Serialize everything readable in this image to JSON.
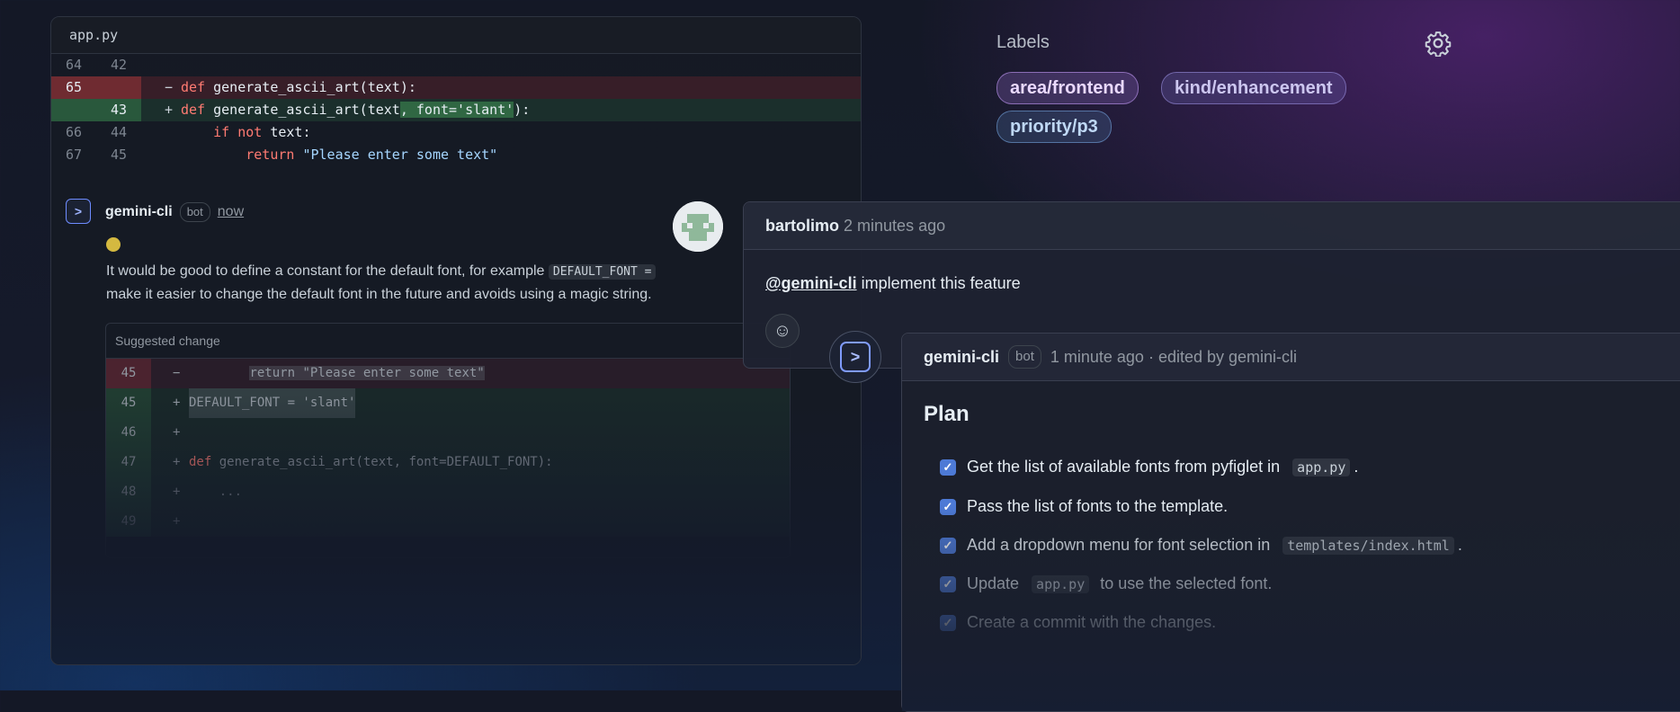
{
  "diff": {
    "filename": "app.py",
    "rows": [
      {
        "old": "64",
        "new": "42",
        "sign": "",
        "code": ""
      },
      {
        "old": "65",
        "new": "",
        "sign": "−",
        "code_kw": "def",
        "code_rest": " generate_ascii_art(text):"
      },
      {
        "old": "",
        "new": "43",
        "sign": "+",
        "code_kw": "def",
        "code_rest": " generate_ascii_art(text",
        "code_hl": ", font='slant'",
        "code_tail": "):"
      },
      {
        "old": "66",
        "new": "44",
        "code_indent": "    ",
        "code_kw": "if not",
        "code_rest": " text:"
      },
      {
        "old": "67",
        "new": "45",
        "code_indent": "        ",
        "code_kw": "return",
        "code_str": " \"Please enter some text\""
      }
    ]
  },
  "bot_comment": {
    "author": "gemini-cli",
    "badge": "bot",
    "time": "now",
    "body_part1": "It would be good to define a constant for the default font, for example",
    "body_code": "DEFAULT_FONT =",
    "body_part2": "make it easier to change the default font in the future and avoids using a magic string.",
    "suggested_title": "Suggested change",
    "suggestion_rows": [
      {
        "ln": "45",
        "sign": "−",
        "code_pre": "        ",
        "code": "return \"Please enter some text\"",
        "type": "del"
      },
      {
        "ln": "45",
        "sign": "+",
        "code": "DEFAULT_FONT = 'slant'",
        "type": "add"
      },
      {
        "ln": "46",
        "sign": "+",
        "code": "",
        "type": "add"
      },
      {
        "ln": "47",
        "sign": "+",
        "code_kw": "def",
        "code": " generate_ascii_art(text, font=DEFAULT_FONT):",
        "type": "add"
      },
      {
        "ln": "48",
        "sign": "+",
        "code": "    ...",
        "type": "add"
      },
      {
        "ln": "49",
        "sign": "+",
        "code": "",
        "type": "add"
      }
    ]
  },
  "labels": {
    "title": "Labels",
    "items": [
      "area/frontend",
      "kind/enhancement",
      "priority/p3"
    ]
  },
  "user_comment": {
    "author": "bartolimo",
    "time": "2 minutes ago",
    "mention": "@gemini-cli",
    "text": " implement this feature"
  },
  "plan_comment": {
    "author": "gemini-cli",
    "badge": "bot",
    "meta": "1 minute ago · edited by gemini-cli",
    "title": "Plan",
    "tasks": [
      {
        "pre": "Get the list of available fonts from pyfiglet in",
        "code": "app.py",
        "post": "."
      },
      {
        "pre": "Pass the list of fonts to the template.",
        "code": "",
        "post": ""
      },
      {
        "pre": "Add a dropdown menu for font selection in",
        "code": "templates/index.html",
        "post": "."
      },
      {
        "pre": "Update",
        "code": "app.py",
        "post": "to use the selected font."
      },
      {
        "pre": "Create a commit with the changes.",
        "code": "",
        "post": ""
      }
    ]
  },
  "colors": {
    "accent": "#4d7ad6",
    "del": "#8c3240",
    "add": "#326e46"
  },
  "icons": [
    "gear-icon",
    "smiley-icon",
    "checkbox-icon",
    "bot-prompt-icon"
  ]
}
